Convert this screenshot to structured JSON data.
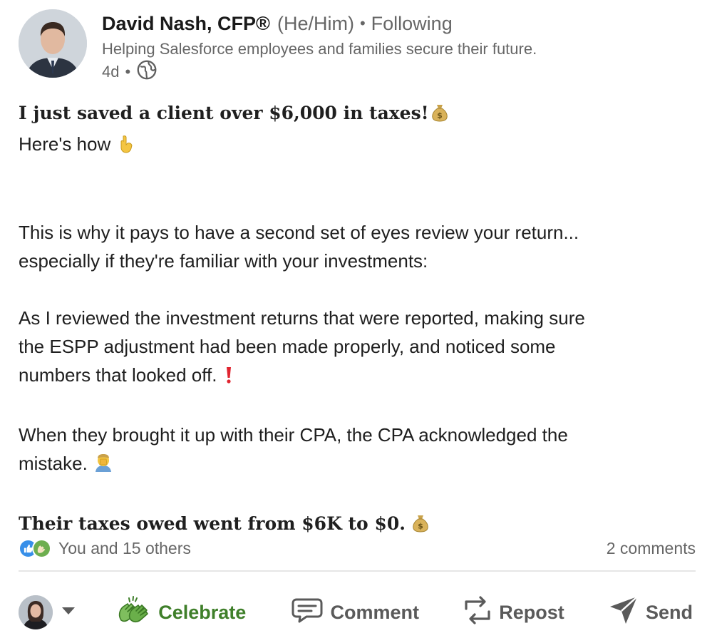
{
  "post": {
    "author": {
      "name": "David Nash, CFP®",
      "pronouns": "(He/Him)",
      "follow_status": "Following",
      "headline": "Helping Salesforce employees and families secure their future.",
      "time_ago": "4d",
      "visibility_icon": "globe-icon"
    },
    "body": {
      "headline": "I just saved a client over $6,000 in taxes!",
      "headline_emoji": "money-bag-icon",
      "intro": "Here's how",
      "intro_emoji": "pointing-down-icon",
      "p1_line1": "This is why it pays to have a second set of eyes review your return...",
      "p1_line2": "especially if they're familiar with your investments:",
      "p2_line1": "As I reviewed the investment returns that were reported, making sure",
      "p2_line2": "the ESPP adjustment had been made properly, and noticed some",
      "p2_line3": "numbers that looked off.",
      "p2_emoji": "red-exclamation-icon",
      "p3_line1": "When they brought it up with their CPA, the CPA acknowledged the",
      "p3_line2": "mistake.",
      "p3_emoji": "facepalm-icon",
      "closing": "Their taxes owed went from $6K to $0.",
      "closing_emoji": "money-bag-icon"
    },
    "social": {
      "reactions_text": "You and 15 others",
      "comments_text": "2 comments"
    },
    "actions": {
      "celebrate": "Celebrate",
      "comment": "Comment",
      "repost": "Repost",
      "send": "Send"
    },
    "colors": {
      "celebrate_green": "#3f7f2a",
      "like_blue": "#378fe9",
      "secondary_text": "#666666"
    }
  }
}
